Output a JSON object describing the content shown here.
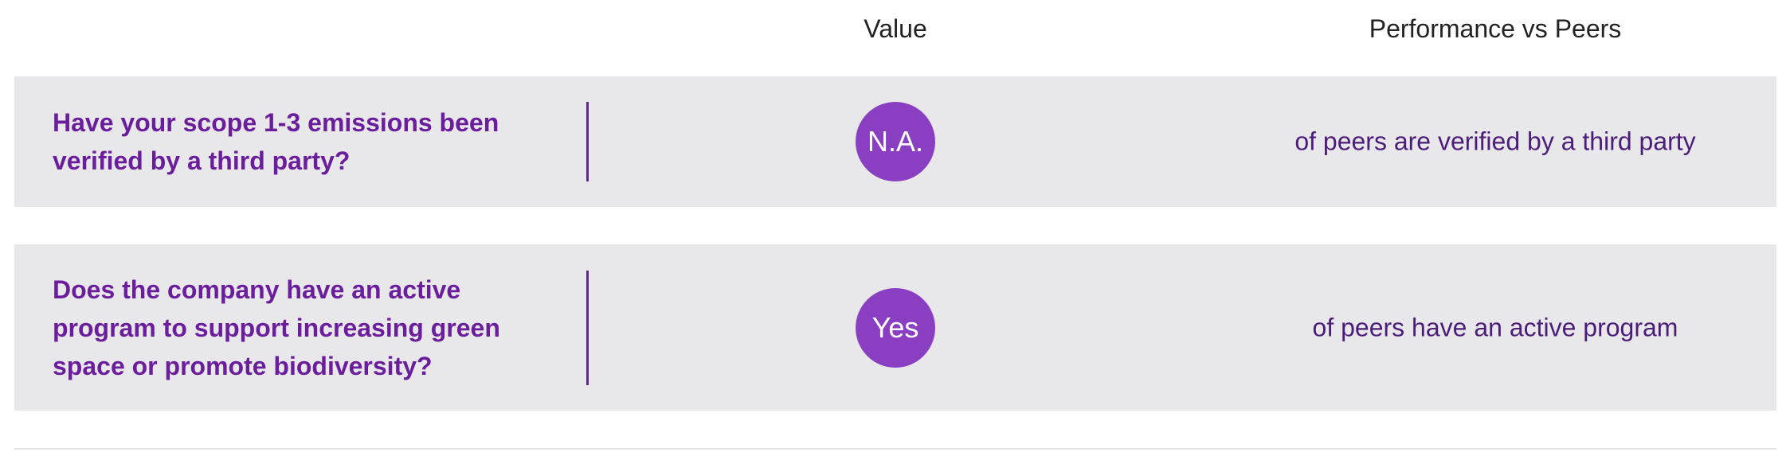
{
  "header": {
    "value_label": "Value",
    "peers_label": "Performance vs Peers"
  },
  "rows": [
    {
      "question": "Have your scope 1-3 emissions been verified by a third party?",
      "value": "N.A.",
      "peer_text": "of peers are verified by a third party"
    },
    {
      "question": "Does the company have an active program to support increasing green space or promote biodiversity?",
      "value": "Yes",
      "peer_text": "of peers have an active program"
    }
  ],
  "colors": {
    "question": "#6b1e9b",
    "value_circle": "#8a3fc2",
    "peer_text": "#4b1d78",
    "row_background": "#e8e8ea"
  }
}
